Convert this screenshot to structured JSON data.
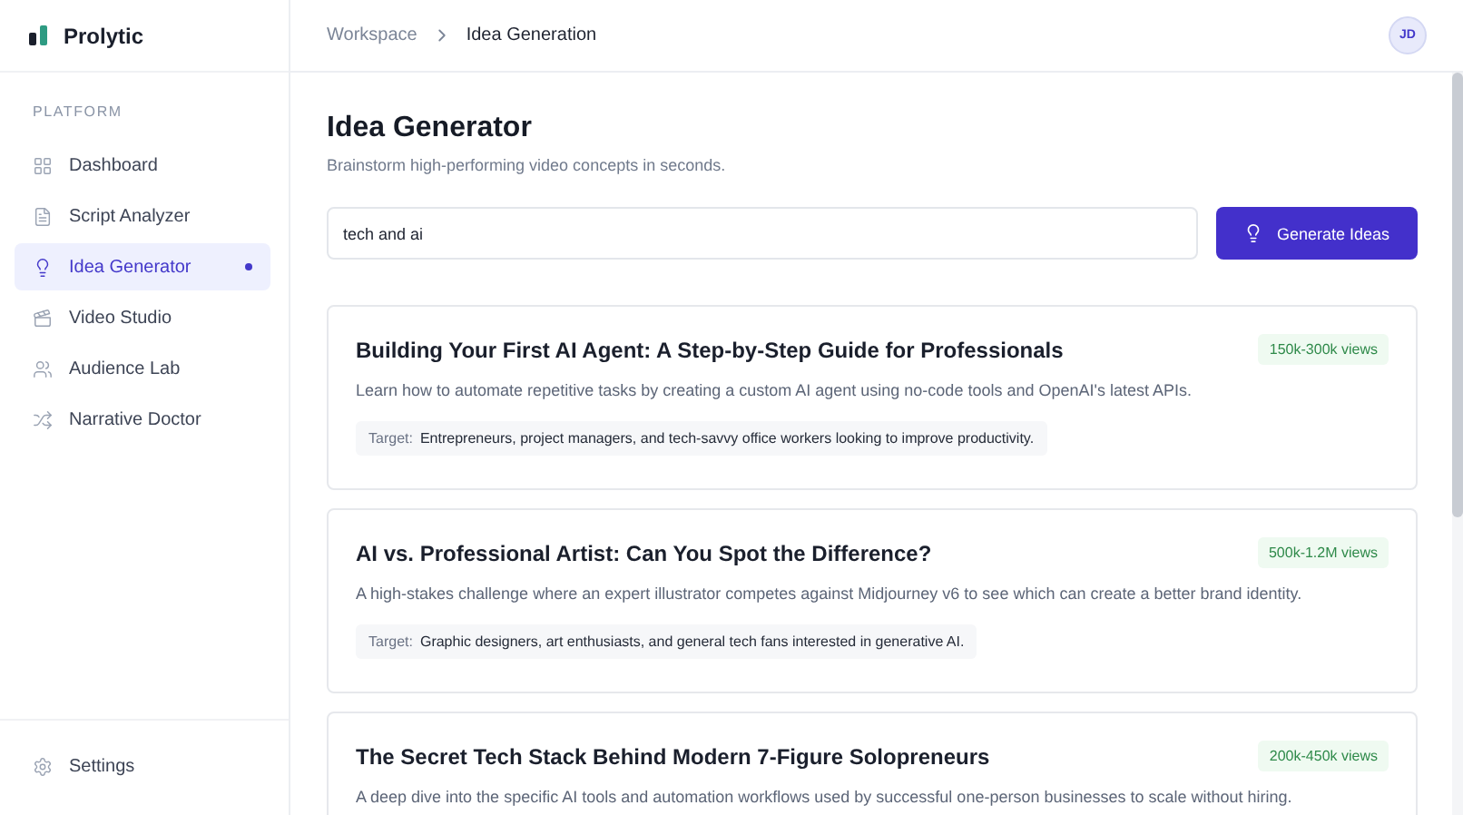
{
  "brand": {
    "name": "Prolytic"
  },
  "sidebar": {
    "section_label": "PLATFORM",
    "items": [
      {
        "label": "Dashboard",
        "selected": false
      },
      {
        "label": "Script Analyzer",
        "selected": false
      },
      {
        "label": "Idea Generator",
        "selected": true
      },
      {
        "label": "Video Studio",
        "selected": false
      },
      {
        "label": "Audience Lab",
        "selected": false
      },
      {
        "label": "Narrative Doctor",
        "selected": false
      }
    ],
    "footer_item": {
      "label": "Settings"
    }
  },
  "breadcrumb": [
    "Workspace",
    "Idea Generation"
  ],
  "user": {
    "initials": "JD"
  },
  "page": {
    "title": "Idea Generator",
    "subtitle": "Brainstorm high-performing video concepts in seconds."
  },
  "search": {
    "value": "tech and ai"
  },
  "generate_button": {
    "label": "Generate Ideas"
  },
  "ideas": [
    {
      "title": "Building Your First AI Agent: A Step-by-Step Guide for Professionals",
      "views": "150k-300k views",
      "description": "Learn how to automate repetitive tasks by creating a custom AI agent using no-code tools and OpenAI's latest APIs.",
      "target_label": "Target:",
      "target": "Entrepreneurs, project managers, and tech-savvy office workers looking to improve productivity."
    },
    {
      "title": "AI vs. Professional Artist: Can You Spot the Difference?",
      "views": "500k-1.2M views",
      "description": "A high-stakes challenge where an expert illustrator competes against Midjourney v6 to see which can create a better brand identity.",
      "target_label": "Target:",
      "target": "Graphic designers, art enthusiasts, and general tech fans interested in generative AI."
    },
    {
      "title": "The Secret Tech Stack Behind Modern 7-Figure Solopreneurs",
      "views": "200k-450k views",
      "description": "A deep dive into the specific AI tools and automation workflows used by successful one-person businesses to scale without hiring."
    }
  ]
}
